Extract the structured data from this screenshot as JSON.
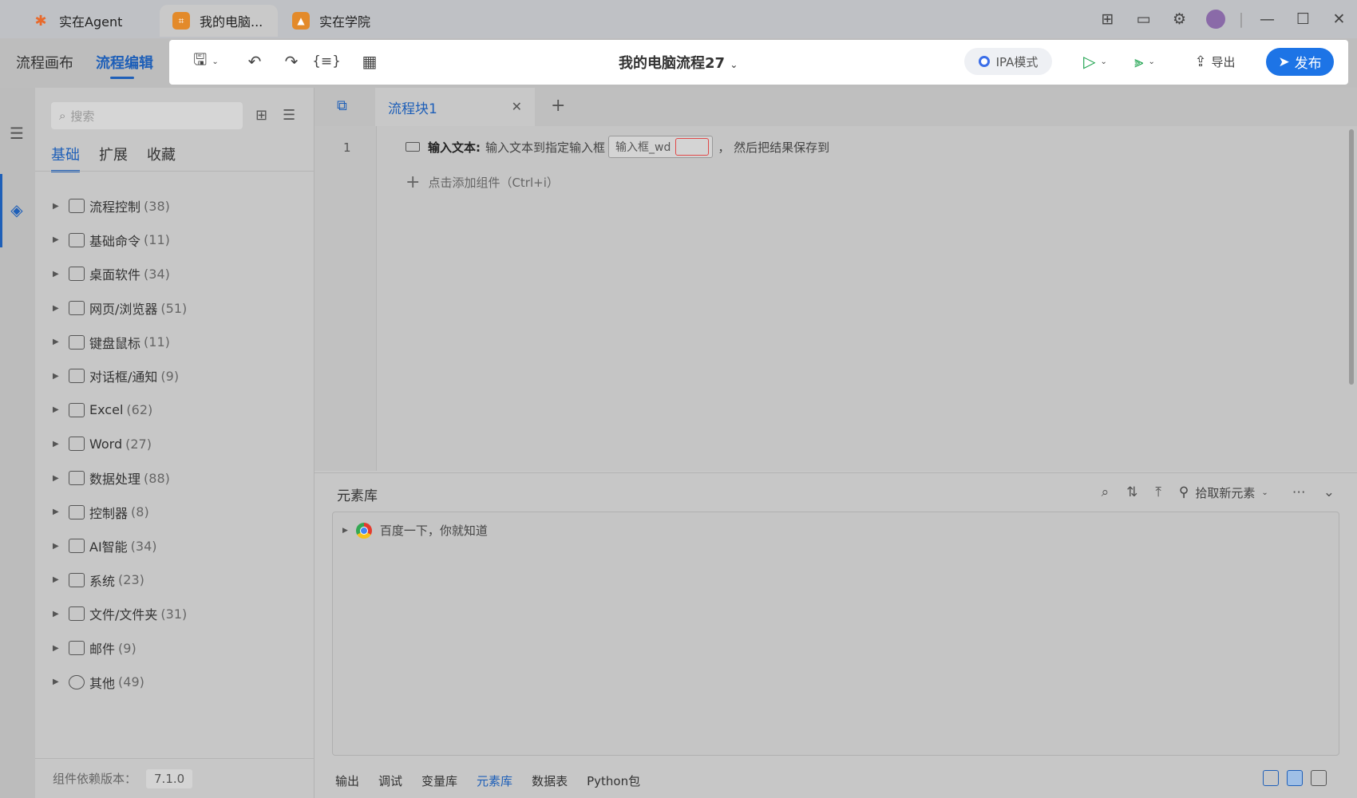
{
  "titlebar": {
    "tabs": [
      {
        "label": "实在Agent",
        "icon": "agent-logo-icon"
      },
      {
        "label": "我的电脑...",
        "icon": "flow-file-icon"
      },
      {
        "label": "实在学院",
        "icon": "academy-icon"
      }
    ],
    "right_icons": [
      "gift-icon",
      "monitor-icon",
      "settings-icon",
      "avatar-icon",
      "minimize-icon",
      "maximize-icon",
      "close-icon"
    ]
  },
  "toolbar": {
    "left_tabs": [
      "流程画布",
      "流程编辑"
    ],
    "flow_title": "我的电脑流程27",
    "ipa_label": "IPA模式",
    "export_label": "导出",
    "publish_label": "发布"
  },
  "sidebar": {
    "search_placeholder": "搜索",
    "tabs": [
      "基础",
      "扩展",
      "收藏"
    ],
    "categories": [
      {
        "name": "流程控制",
        "count": "(38)"
      },
      {
        "name": "基础命令",
        "count": "(11)"
      },
      {
        "name": "桌面软件",
        "count": "(34)"
      },
      {
        "name": "网页/浏览器",
        "count": "(51)"
      },
      {
        "name": "键盘鼠标",
        "count": "(11)"
      },
      {
        "name": "对话框/通知",
        "count": "(9)"
      },
      {
        "name": "Excel",
        "count": "(62)"
      },
      {
        "name": "Word",
        "count": "(27)"
      },
      {
        "name": "数据处理",
        "count": "(88)"
      },
      {
        "name": "控制器",
        "count": "(8)"
      },
      {
        "name": "AI智能",
        "count": "(34)"
      },
      {
        "name": "系统",
        "count": "(23)"
      },
      {
        "name": "文件/文件夹",
        "count": "(31)"
      },
      {
        "name": "邮件",
        "count": "(9)"
      },
      {
        "name": "其他",
        "count": "(49)"
      }
    ],
    "version_label": "组件依赖版本：",
    "version_value": "7.1.0"
  },
  "editor": {
    "tab_label": "流程块1",
    "line_number": "1",
    "step": {
      "name": "输入文本:",
      "desc": "输入文本到指定输入框",
      "target": "输入框_wd",
      "suffix": "， 然后把结果保存到"
    },
    "add_component": "点击添加组件（Ctrl+i）"
  },
  "element_library": {
    "title": "元素库",
    "pick_label": "拾取新元素",
    "tree_item": "百度一下，你就知道",
    "bottom_tabs": [
      "输出",
      "调试",
      "变量库",
      "元素库",
      "数据表",
      "Python包"
    ],
    "active_bottom_tab": "元素库"
  },
  "colors": {
    "accent": "#1e5fb8",
    "publish": "#1d74e6",
    "error": "#e04848"
  }
}
